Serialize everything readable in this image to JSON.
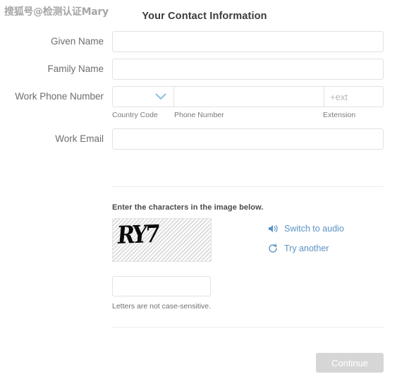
{
  "watermark": {
    "text": "搜狐号@检测认证Mary"
  },
  "header": {
    "title": "Your Contact Information"
  },
  "form": {
    "fields": [
      {
        "label": "Given Name",
        "value": "",
        "placeholder": ""
      },
      {
        "label": "Family Name",
        "value": "",
        "placeholder": ""
      }
    ],
    "phone": {
      "label": "Work Phone Number",
      "country_code_value": "",
      "country_code_icon": "chevron-down-icon",
      "phone_number_value": "",
      "extension_value": "",
      "extension_placeholder": "+ext",
      "sublabels": {
        "country_code": "Country Code",
        "phone_number": "Phone Number",
        "extension": "Extension"
      }
    },
    "email": {
      "label": "Work Email",
      "value": "",
      "placeholder": ""
    }
  },
  "captcha": {
    "instruction": "Enter the characters in the image below.",
    "image_characters": "RY7",
    "image_alt": "captcha-image",
    "audio_link": {
      "label": "Switch to audio",
      "icon": "speaker-icon"
    },
    "refresh_link": {
      "label": "Try another",
      "icon": "refresh-icon"
    },
    "input_value": "",
    "input_placeholder": "",
    "note": "Letters are not case-sensitive."
  },
  "footer": {
    "continue_label": "Continue",
    "continue_disabled": true
  },
  "colors": {
    "link_blue": "#5b93c4",
    "chevron_blue": "#8fc0e0",
    "border_gray": "#e2e2e2",
    "button_disabled": "#d6d6d6",
    "title_gray": "#3b3b3b",
    "label_gray": "#6d6d6d"
  }
}
